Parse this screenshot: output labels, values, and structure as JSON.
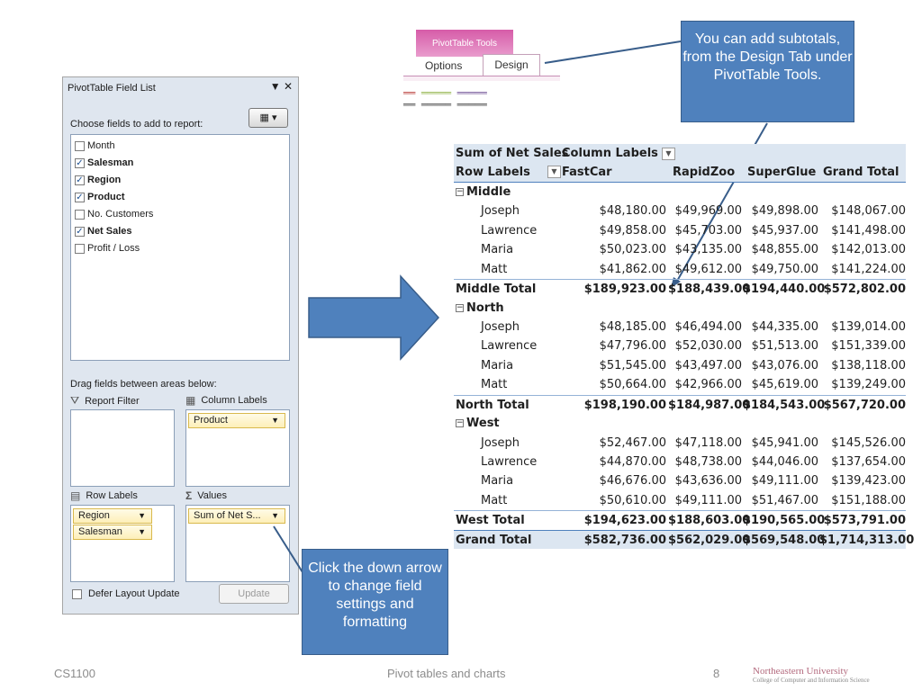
{
  "field_list": {
    "title": "PivotTable Field List",
    "header_icons": "▼ ✕",
    "choose_label": "Choose fields to add to report:",
    "layout_icon": "▦ ▾",
    "fields": [
      {
        "label": "Month",
        "checked": false
      },
      {
        "label": "Salesman",
        "checked": true
      },
      {
        "label": "Region",
        "checked": true
      },
      {
        "label": "Product",
        "checked": true
      },
      {
        "label": "No. Customers",
        "checked": false
      },
      {
        "label": "Net Sales",
        "checked": true
      },
      {
        "label": "Profit / Loss",
        "checked": false
      }
    ],
    "drag_label": "Drag fields between areas below:",
    "areas": {
      "report_filter": "Report Filter",
      "column_labels": "Column Labels",
      "row_labels": "Row Labels",
      "values": "Values"
    },
    "column_chips": [
      "Product"
    ],
    "row_chips": [
      "Region",
      "Salesman"
    ],
    "value_chips": [
      "Sum of Net S..."
    ],
    "defer_label": "Defer Layout Update",
    "update_label": "Update"
  },
  "ribbon": {
    "tools_label": "PivotTable Tools",
    "tab_options": "Options",
    "tab_design": "Design"
  },
  "callouts": {
    "top": "You can add subtotals, from the Design Tab under PivotTable Tools.",
    "bottom": "Click the down arrow to change field settings and formatting"
  },
  "pivot": {
    "corner": "Sum of Net Sales",
    "column_labels": "Column Labels",
    "row_labels": "Row Labels",
    "columns": [
      "FastCar",
      "RapidZoo",
      "SuperGlue",
      "Grand Total"
    ],
    "groups": [
      {
        "region": "Middle",
        "rows": [
          {
            "name": "Joseph",
            "values": [
              "$48,180.00",
              "$49,969.00",
              "$49,898.00",
              "$148,067.00"
            ]
          },
          {
            "name": "Lawrence",
            "values": [
              "$49,858.00",
              "$45,703.00",
              "$45,937.00",
              "$141,498.00"
            ]
          },
          {
            "name": "Maria",
            "values": [
              "$50,023.00",
              "$43,135.00",
              "$48,855.00",
              "$142,013.00"
            ]
          },
          {
            "name": "Matt",
            "values": [
              "$41,862.00",
              "$49,612.00",
              "$49,750.00",
              "$141,224.00"
            ]
          }
        ],
        "total_label": "Middle Total",
        "total": [
          "$189,923.00",
          "$188,439.00",
          "$194,440.00",
          "$572,802.00"
        ]
      },
      {
        "region": "North",
        "rows": [
          {
            "name": "Joseph",
            "values": [
              "$48,185.00",
              "$46,494.00",
              "$44,335.00",
              "$139,014.00"
            ]
          },
          {
            "name": "Lawrence",
            "values": [
              "$47,796.00",
              "$52,030.00",
              "$51,513.00",
              "$151,339.00"
            ]
          },
          {
            "name": "Maria",
            "values": [
              "$51,545.00",
              "$43,497.00",
              "$43,076.00",
              "$138,118.00"
            ]
          },
          {
            "name": "Matt",
            "values": [
              "$50,664.00",
              "$42,966.00",
              "$45,619.00",
              "$139,249.00"
            ]
          }
        ],
        "total_label": "North Total",
        "total": [
          "$198,190.00",
          "$184,987.00",
          "$184,543.00",
          "$567,720.00"
        ]
      },
      {
        "region": "West",
        "rows": [
          {
            "name": "Joseph",
            "values": [
              "$52,467.00",
              "$47,118.00",
              "$45,941.00",
              "$145,526.00"
            ]
          },
          {
            "name": "Lawrence",
            "values": [
              "$44,870.00",
              "$48,738.00",
              "$44,046.00",
              "$137,654.00"
            ]
          },
          {
            "name": "Maria",
            "values": [
              "$46,676.00",
              "$43,636.00",
              "$49,111.00",
              "$139,423.00"
            ]
          },
          {
            "name": "Matt",
            "values": [
              "$50,610.00",
              "$49,111.00",
              "$51,467.00",
              "$151,188.00"
            ]
          }
        ],
        "total_label": "West Total",
        "total": [
          "$194,623.00",
          "$188,603.00",
          "$190,565.00",
          "$573,791.00"
        ]
      }
    ],
    "grand_label": "Grand Total",
    "grand": [
      "$582,736.00",
      "$562,029.00",
      "$569,548.00",
      "$1,714,313.00"
    ]
  },
  "footer": {
    "left": "CS1100",
    "center": "Pivot tables and charts",
    "page": "8",
    "logo_line1": "Northeastern University",
    "logo_line2": "College of Computer and Information Science"
  },
  "colors": {
    "callout": "#4f81bd",
    "pivot_header": "#dce6f1",
    "ribbon_tools": "#d65ca8"
  }
}
